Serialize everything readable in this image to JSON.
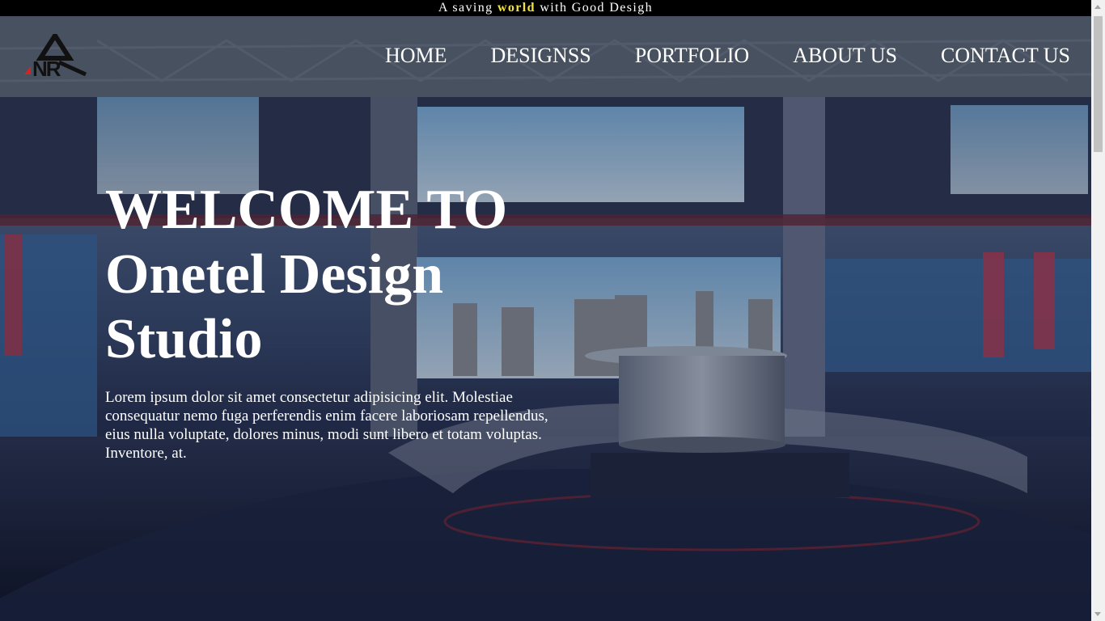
{
  "topbar": {
    "text_before": "A saving ",
    "highlight": "world",
    "text_after": " with Good Desigh",
    "highlight_color": "#f4e23a"
  },
  "logo": {
    "letters": "ANR",
    "alt": "ANR logo",
    "accent": "#e02020"
  },
  "nav": {
    "items": [
      {
        "label": "HOME"
      },
      {
        "label": "DESIGNSS"
      },
      {
        "label": "PORTFOLIO"
      },
      {
        "label": "ABOUT US"
      },
      {
        "label": "CONTACT US"
      }
    ]
  },
  "hero": {
    "title_line1": "WELCOME TO",
    "title_line2": "Onetel Design",
    "title_line3": "Studio",
    "description": "Lorem ipsum dolor sit amet consectetur adipisicing elit. Molestiae consequatur nemo fuga perferendis enim facere laboriosam repellendus, eius nulla voluptate, dolores minus, modi sunt libero et totam voluptas. Inventore, at."
  }
}
